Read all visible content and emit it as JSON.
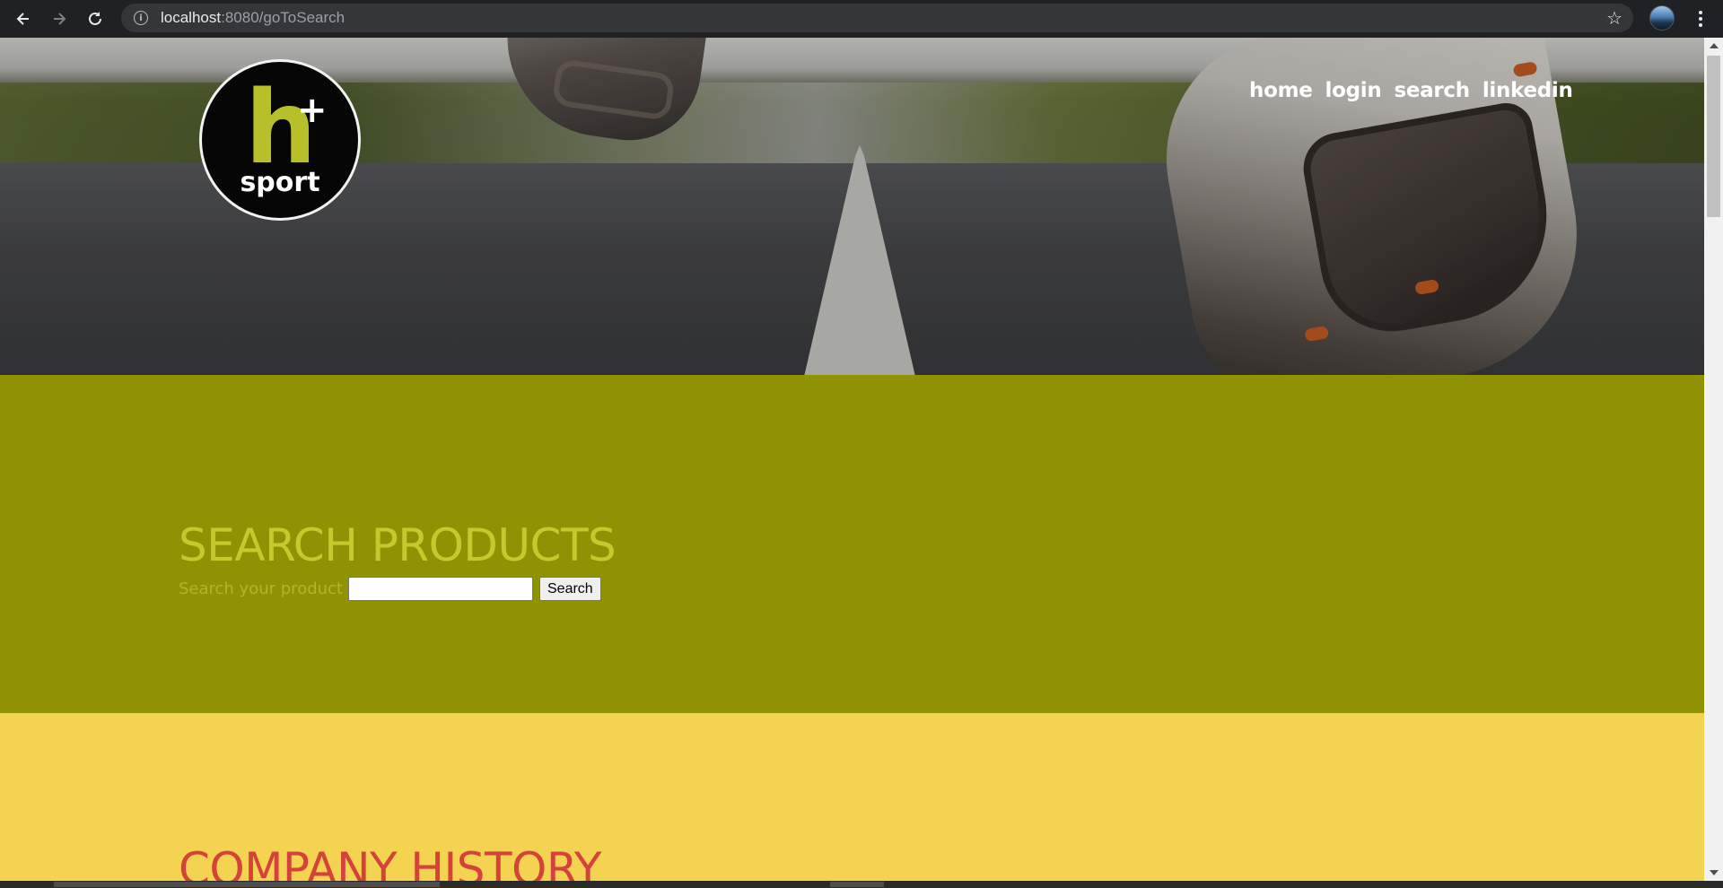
{
  "browser": {
    "url_host": "localhost",
    "url_rest": ":8080/goToSearch"
  },
  "logo": {
    "letter": "h",
    "plus": "+",
    "word": "sport"
  },
  "nav": {
    "items": [
      "home",
      "login",
      "search",
      "linkedin"
    ]
  },
  "search_section": {
    "title": "SEARCH PRODUCTS",
    "label": "Search your product",
    "input_value": "",
    "button_label": "Search"
  },
  "history_section": {
    "title": "COMPANY HISTORY"
  },
  "colors": {
    "search_bg": "#8e9203",
    "search_title": "#c5c92b",
    "history_bg": "#f3d34f",
    "history_title": "#d5423c",
    "logo_accent": "#b7bf2b"
  }
}
